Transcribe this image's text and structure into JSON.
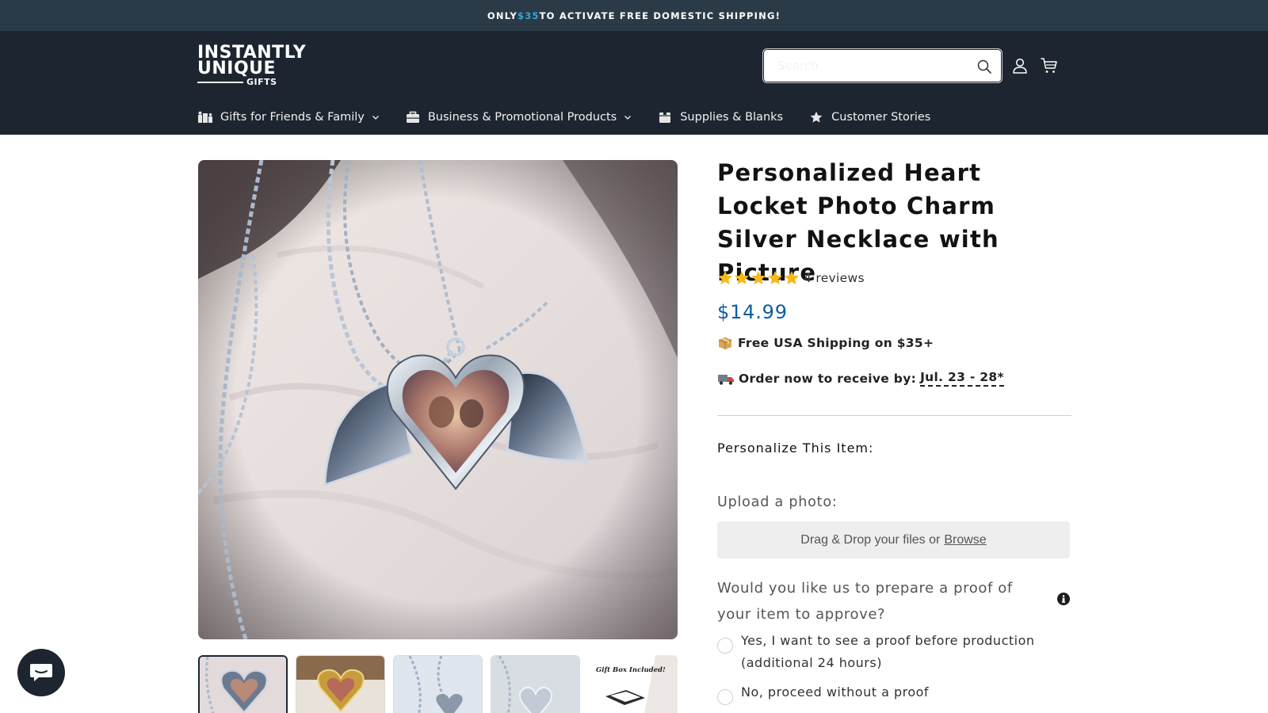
{
  "announcement": {
    "before": "ONLY ",
    "highlight": "$35",
    "after": " TO ACTIVATE FREE DOMESTIC SHIPPING!",
    "highlight_color": "#2ea8e0",
    "background": "#2a3b47"
  },
  "header": {
    "logo": {
      "line1": "INSTANTLY",
      "line2": "UNIQUE",
      "line3": "GIFTS"
    },
    "search_placeholder": "Search",
    "background": "#1d2530"
  },
  "nav": {
    "items": [
      {
        "label": "Gifts for Friends & Family",
        "icon": "family-icon",
        "has_dropdown": true
      },
      {
        "label": "Business & Promotional Products",
        "icon": "briefcase-icon",
        "has_dropdown": true
      },
      {
        "label": "Supplies & Blanks",
        "icon": "box-icon",
        "has_dropdown": false
      },
      {
        "label": "Customer Stories",
        "icon": "star-icon",
        "has_dropdown": false
      }
    ]
  },
  "gallery": {
    "thumbnail_gift_box_caption": "Gift Box Included!"
  },
  "product": {
    "title": "Personalized Heart Locket Photo Charm Silver Necklace with Picture",
    "rating_stars": 5,
    "reviews_text": "4 reviews",
    "price": "$14.99",
    "price_color": "#0e5da3",
    "shipping_text": "Free USA Shipping on $35+",
    "delivery_prefix": "Order now to receive by:",
    "delivery_date": "Jul. 23 - 28*",
    "personalize_heading": "Personalize This Item:",
    "upload_label": "Upload a photo:",
    "dropzone_text": "Drag & Drop your files or",
    "dropzone_link": "Browse",
    "proof_question": "Would you like us to prepare a proof of your item to approve?",
    "proof_options": [
      "Yes, I want to see a proof before production (additional 24 hours)",
      "No, proceed without a proof"
    ]
  }
}
